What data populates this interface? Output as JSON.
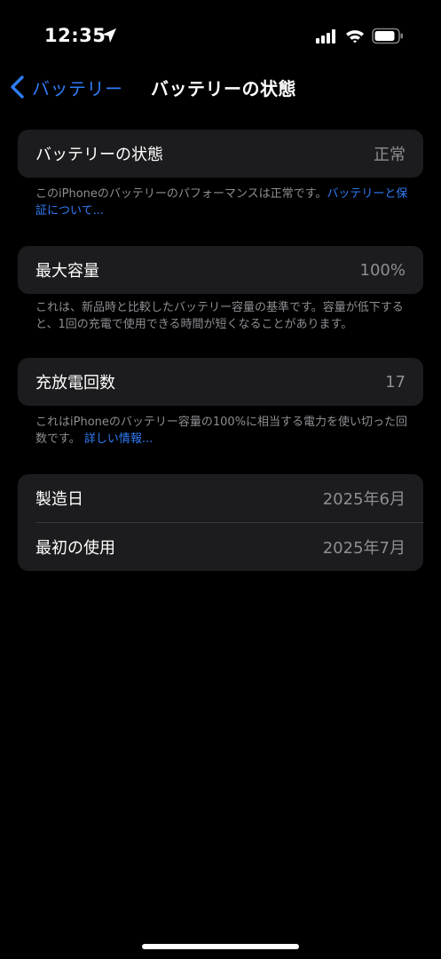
{
  "status_bar": {
    "time": "12:35",
    "icons": [
      "location-arrow-icon",
      "cellular-signal-icon",
      "wifi-icon",
      "battery-icon"
    ]
  },
  "nav": {
    "back_label": "バッテリー",
    "title": "バッテリーの状態"
  },
  "sections": {
    "health": {
      "label": "バッテリーの状態",
      "value": "正常",
      "footnote": "このiPhoneのバッテリーのパフォーマンスは正常です。",
      "footnote_link": "バッテリーと保証について..."
    },
    "capacity": {
      "label": "最大容量",
      "value": "100%",
      "footnote": "これは、新品時と比較したバッテリー容量の基準です。容量が低下すると、1回の充電で使用できる時間が短くなることがあります。"
    },
    "cycles": {
      "label": "充放電回数",
      "value": "17",
      "footnote": "これはiPhoneのバッテリー容量の100%に相当する電力を使い切った回数です。",
      "footnote_link": "詳しい情報..."
    },
    "dates": {
      "manufacture_label": "製造日",
      "manufacture_value": "2025年6月",
      "first_use_label": "最初の使用",
      "first_use_value": "2025年7月"
    }
  },
  "colors": {
    "accent": "#2f7cf6",
    "background": "#000000",
    "card": "#1c1c1e",
    "secondary_text": "#8e8e93"
  }
}
